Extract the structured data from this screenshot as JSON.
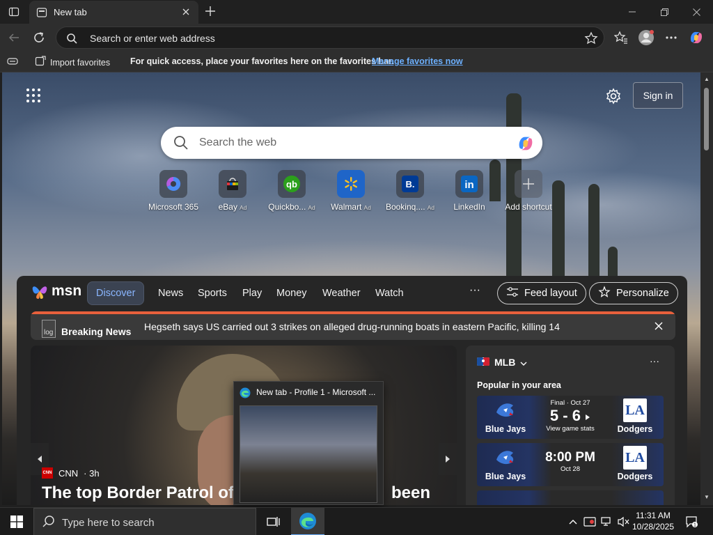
{
  "browser": {
    "tab_title": "New tab",
    "address_placeholder": "Search or enter web address",
    "favorites_bar": {
      "import_label": "Import favorites",
      "message": "For quick access, place your favorites here on the favorites bar.",
      "manage_link": "Manage favorites now"
    }
  },
  "ntp": {
    "signin_label": "Sign in",
    "search_placeholder": "Search the web",
    "shortcuts": [
      {
        "label": "Microsoft 365",
        "ad": "",
        "icon": "microsoft-365-icon"
      },
      {
        "label": "eBay",
        "ad": "Ad",
        "icon": "ebay-icon"
      },
      {
        "label": "Quickbo...",
        "ad": "Ad",
        "icon": "quickbooks-icon"
      },
      {
        "label": "Walmart",
        "ad": "Ad",
        "icon": "walmart-icon"
      },
      {
        "label": "Bookinq....",
        "ad": "Ad",
        "icon": "booking-icon"
      },
      {
        "label": "LinkedIn",
        "ad": "",
        "icon": "linkedin-icon"
      },
      {
        "label": "Add shortcut",
        "ad": "",
        "icon": "plus-icon"
      }
    ]
  },
  "feed": {
    "logo_text": "msn",
    "nav": [
      "Discover",
      "News",
      "Sports",
      "Play",
      "Money",
      "Weather",
      "Watch"
    ],
    "more": "···",
    "feed_layout_label": "Feed layout",
    "personalize_label": "Personalize",
    "breaking": {
      "img_alt": "log",
      "label": "Breaking News",
      "headline": "Hegseth says US carried out 3 strikes on alleged drug-running boats in eastern Pacific, killing 14"
    },
    "hero": {
      "source": "CNN",
      "source_logo": "CNN",
      "age": "· 3h",
      "title": "The top Border Patrol offi",
      "title_tail": "been"
    },
    "mlb": {
      "title": "MLB",
      "subtitle": "Popular in your area",
      "more": "···",
      "games": [
        {
          "away": "Blue Jays",
          "home": "Dodgers",
          "status": "Final · Oct 27",
          "score": "5 - 6",
          "footer": "View game stats"
        },
        {
          "away": "Blue Jays",
          "home": "Dodgers",
          "status": "",
          "score": "8:00 PM",
          "footer": "Oct 28"
        }
      ]
    }
  },
  "thumbnail": {
    "title": "New tab - Profile 1 - Microsoft ..."
  },
  "taskbar": {
    "search_placeholder": "Type here to search",
    "time": "11:31 AM",
    "date": "10/28/2025"
  },
  "colors": {
    "accent_link": "#6cb0ff",
    "breaking_bar": "#e8603c",
    "discover_active": "#8ab6ff"
  }
}
